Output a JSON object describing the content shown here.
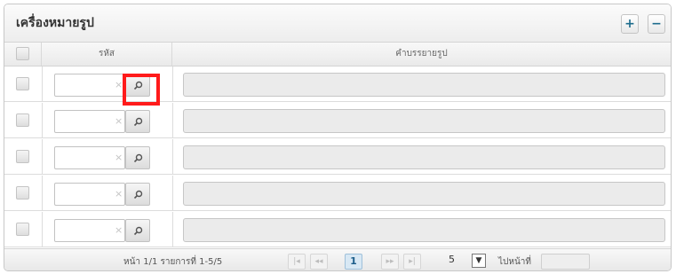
{
  "panel": {
    "title": "เครื่องหมายรูป",
    "add_label": "+",
    "remove_label": "−"
  },
  "table": {
    "columns": [
      "รหัส",
      "คำบรรยายรูป"
    ],
    "clear_glyph": "×",
    "rows": [
      {},
      {},
      {},
      {},
      {}
    ]
  },
  "pager": {
    "info": "หน้า 1/1 รายการที่ 1-5/5",
    "first_label": "|◂",
    "prev_label": "◂◂",
    "current_page": "1",
    "next_label": "▸▸",
    "last_label": "▸|",
    "page_size": "5",
    "dropdown_arrow": "▼",
    "goto_label": "ไปหน้าที่"
  }
}
